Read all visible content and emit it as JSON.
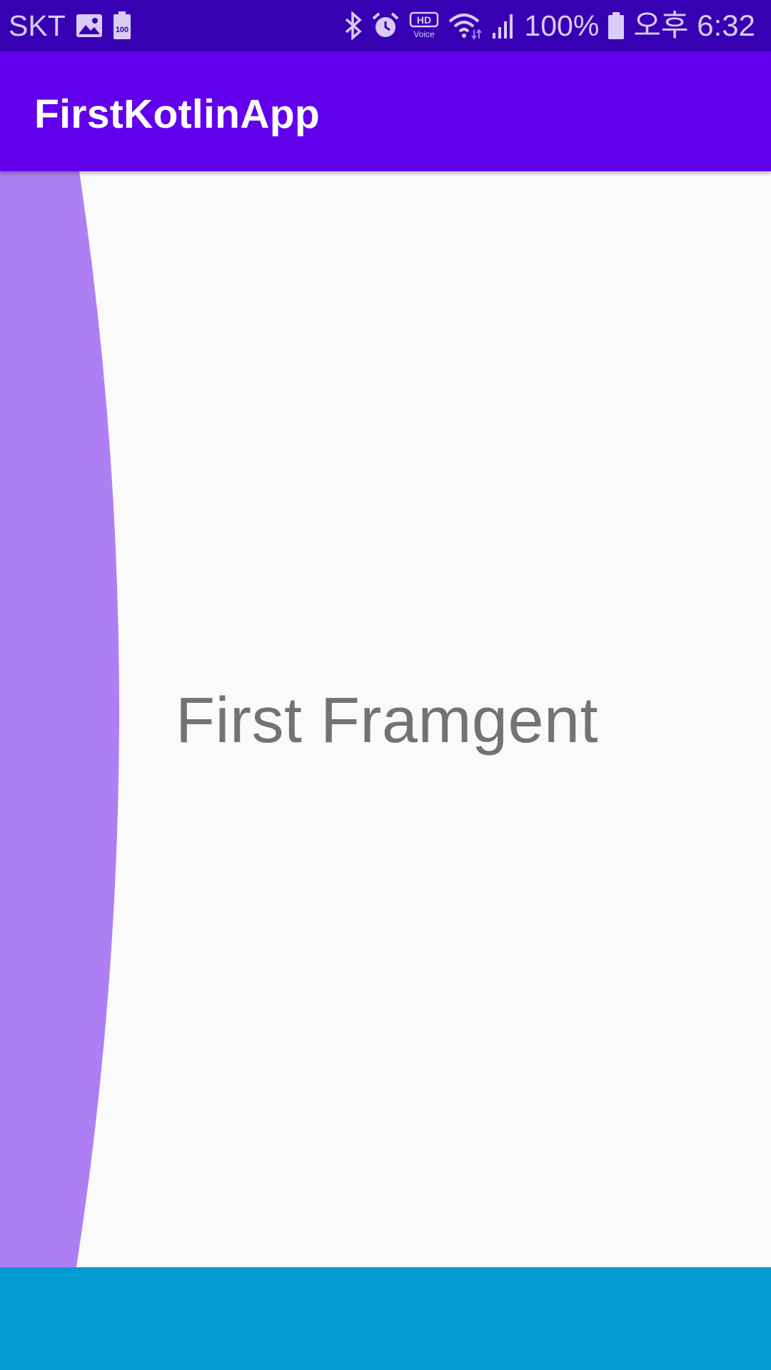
{
  "status_bar": {
    "carrier": "SKT",
    "left_icons": [
      "image-icon",
      "battery-saver-100-icon"
    ],
    "battery_saver_level": "100",
    "right_icons": [
      "bluetooth-icon",
      "alarm-icon",
      "hd-voice-icon",
      "wifi-icon",
      "signal-icon",
      "battery-icon"
    ],
    "hd_label": "HD",
    "voice_label": "Voice",
    "battery_percent": "100%",
    "time": "오후 6:32"
  },
  "app_bar": {
    "title": "FirstKotlinApp"
  },
  "content": {
    "fragment_text": "First Framgent"
  },
  "colors": {
    "status_bar": "#3700b3",
    "app_bar": "#6200ee",
    "background": "#fafafa",
    "drawer_edge": "#ae7ff4",
    "fragment_text": "#737373",
    "bottom_bar": "#009bcf"
  }
}
